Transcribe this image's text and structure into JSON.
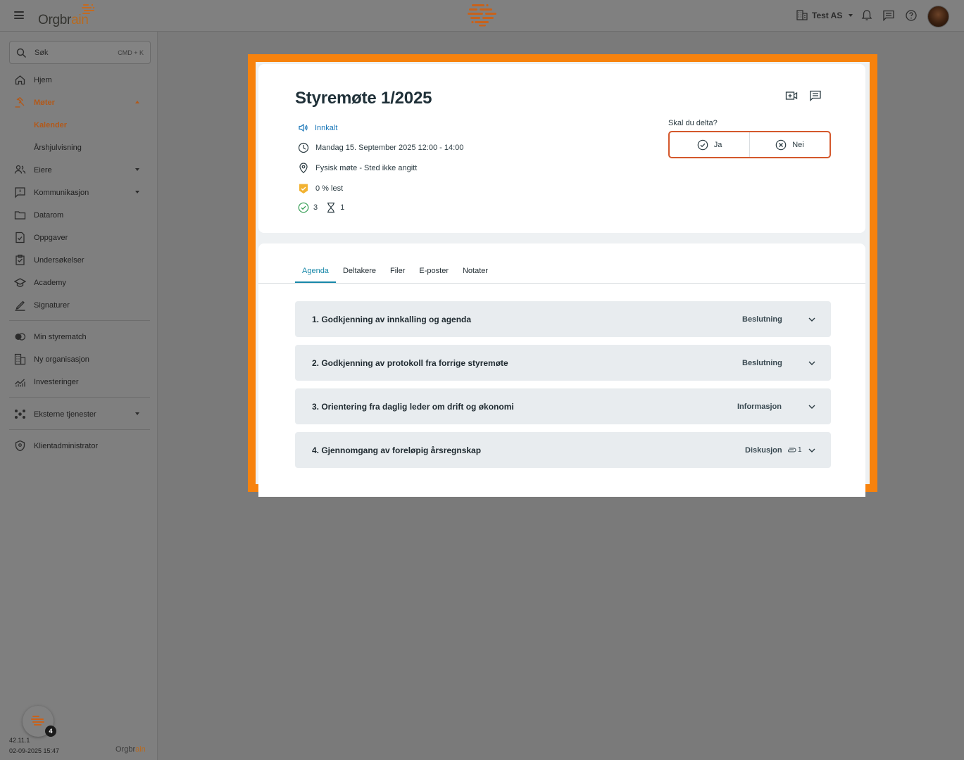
{
  "app": {
    "logo_text_main": "Orgbr",
    "logo_text_accent": "ain",
    "org_name": "Test AS"
  },
  "sidebar": {
    "search_label": "Søk",
    "search_shortcut": "CMD + K",
    "items": [
      {
        "label": "Hjem",
        "icon": "home-icon"
      },
      {
        "label": "Møter",
        "icon": "gavel-icon"
      },
      {
        "label": "Kalender"
      },
      {
        "label": "Årshjulvisning"
      },
      {
        "label": "Eiere",
        "icon": "people-icon"
      },
      {
        "label": "Kommunikasjon",
        "icon": "message-icon"
      },
      {
        "label": "Datarom",
        "icon": "folder-icon"
      },
      {
        "label": "Oppgaver",
        "icon": "task-icon"
      },
      {
        "label": "Undersøkelser",
        "icon": "survey-icon"
      },
      {
        "label": "Academy",
        "icon": "graduation-icon"
      },
      {
        "label": "Signaturer",
        "icon": "pen-icon"
      },
      {
        "label": "Min styrematch",
        "icon": "toggle-icon"
      },
      {
        "label": "Ny organisasjon",
        "icon": "building-icon"
      },
      {
        "label": "Investeringer",
        "icon": "chart-icon"
      },
      {
        "label": "Eksterne tjenester",
        "icon": "services-icon"
      },
      {
        "label": "Klientadministrator",
        "icon": "shield-icon"
      }
    ],
    "version": "42.11.1",
    "build_time": "02-09-2025 15:47",
    "notification_count": "4",
    "footer_logo_main": "Orgbr",
    "footer_logo_accent": "ain"
  },
  "meeting": {
    "title": "Styremøte 1/2025",
    "status": "Innkalt",
    "datetime": "Mandag 15. September 2025 12:00 - 14:00",
    "location": "Fysisk møte - Sted ikke angitt",
    "read_status": "0 % lest",
    "accepted_count": "3",
    "pending_count": "1",
    "attend_question": "Skal du delta?",
    "attend_yes": "Ja",
    "attend_no": "Nei"
  },
  "tabs": [
    "Agenda",
    "Deltakere",
    "Filer",
    "E-poster",
    "Notater"
  ],
  "agenda": [
    {
      "title": "1. Godkjenning av innkalling og agenda",
      "type": "Beslutning"
    },
    {
      "title": "2. Godkjenning av protokoll fra forrige styremøte",
      "type": "Beslutning"
    },
    {
      "title": "3. Orientering fra daglig leder om drift og økonomi",
      "type": "Informasjon"
    },
    {
      "title": "4. Gjennomgang av foreløpig årsregnskap",
      "type": "Diskusjon",
      "attachments": "1"
    }
  ],
  "colors": {
    "accent": "#f7820d",
    "active_nav": "#b2591a",
    "tab_active": "#1787a8",
    "status_blue": "#1976b8",
    "attend_border": "#d4582c"
  }
}
